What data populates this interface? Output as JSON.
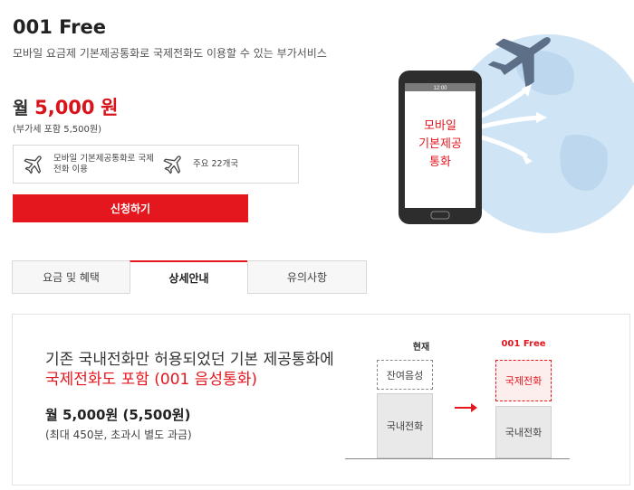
{
  "product": {
    "title": "001 Free",
    "subtitle": "모바일 요금제 기본제공통화로 국제전화도 이용할 수 있는 부가서비스"
  },
  "price": {
    "prefix": "월",
    "amount": "5,000",
    "unit": "원",
    "vat_note": "(부가세 포함 5,500원)"
  },
  "features": [
    {
      "icon": "airplane-icon",
      "text": "모바일 기본제공통화로 국제전화 이용"
    },
    {
      "icon": "airplane-icon",
      "text": "주요 22개국"
    }
  ],
  "apply_button": "신청하기",
  "hero": {
    "phone_time": "12:00",
    "phone_text": [
      "모바일",
      "기본제공",
      "통화"
    ]
  },
  "tabs": [
    {
      "label": "요금 및 혜택",
      "active": false
    },
    {
      "label": "상세안내",
      "active": true
    },
    {
      "label": "유의사항",
      "active": false
    }
  ],
  "detail": {
    "line1": "기존 국내전화만 허용되었던 기본 제공통화에",
    "line2": "국제전화도 포함 (001 음성통화)",
    "price": "월 5,000원 (5,500원)",
    "note": "(최대 450분, 초과시 별도 과금)",
    "compare": {
      "now_label": "현재",
      "new_label": "001 Free",
      "remaining_voice": "잔여음성",
      "domestic": "국내전화",
      "international": "국제전화"
    }
  },
  "colors": {
    "accent": "#e4161e",
    "globe": "#cfe4f5",
    "phone": "#2d2d2d"
  }
}
